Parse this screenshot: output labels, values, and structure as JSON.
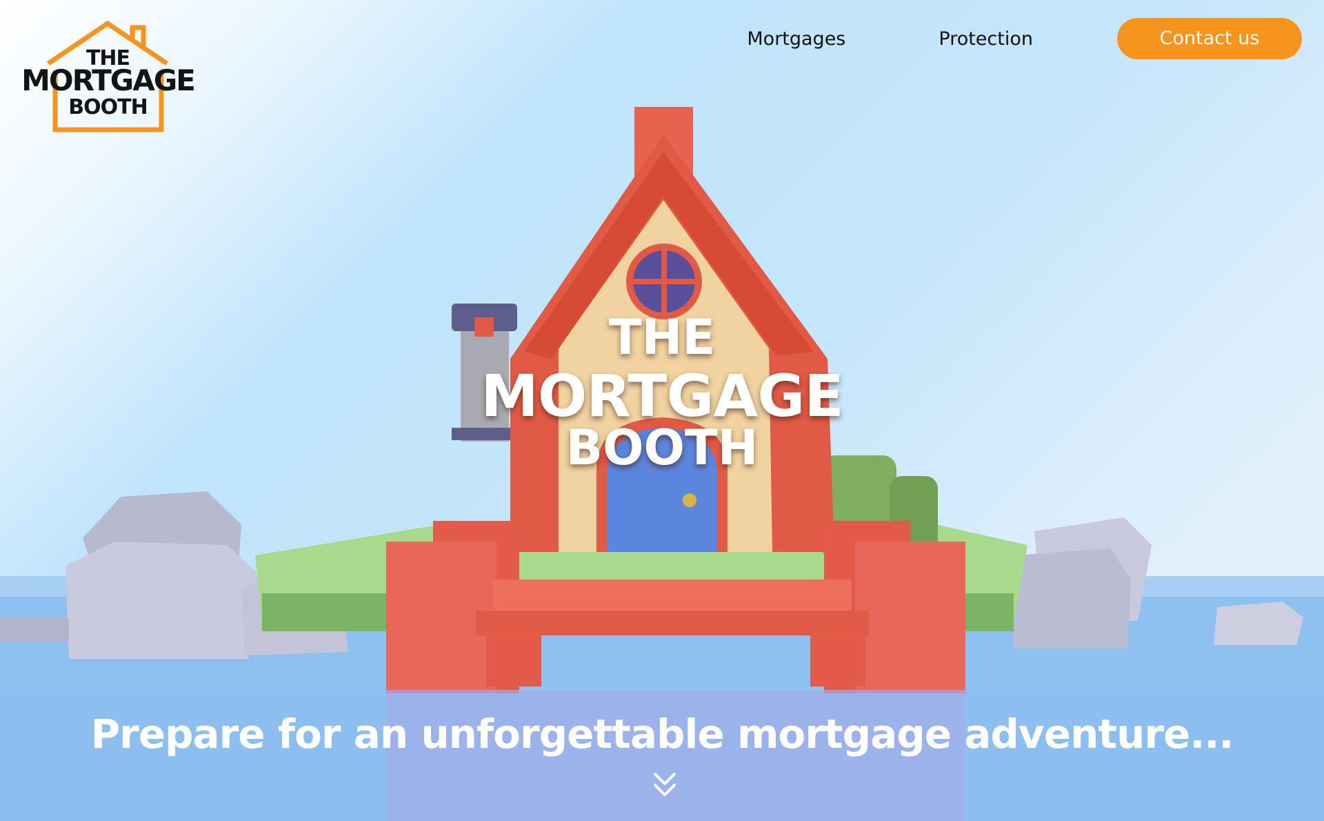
{
  "brand": {
    "logo_line1": "THE",
    "logo_line2": "MORTGAGE",
    "logo_line3": "BOOTH",
    "accent_color": "#f7941d"
  },
  "nav": {
    "items": [
      {
        "label": "Mortgages"
      },
      {
        "label": "Protection"
      }
    ],
    "cta_label": "Contact us"
  },
  "hero": {
    "title_line1": "THE",
    "title_line2": "MORTGAGE",
    "title_line3": "BOOTH",
    "tagline": "Prepare for an unforgettable mortgage adventure...",
    "scroll_icon": "double-chevron-down-icon"
  }
}
